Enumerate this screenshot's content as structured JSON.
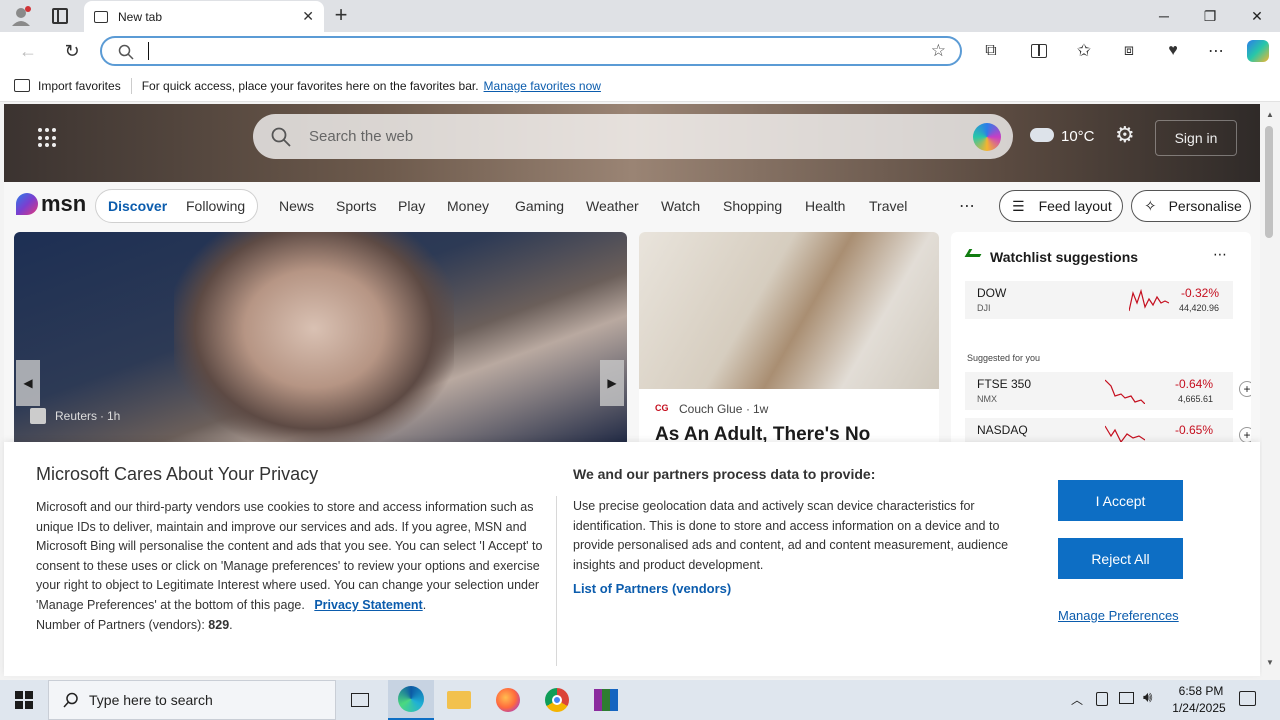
{
  "browser": {
    "tab_title": "New tab",
    "address_value": "",
    "favorites_bar": {
      "import_label": "Import favorites",
      "message": "For quick access, place your favorites here on the favorites bar.",
      "manage_link": "Manage favorites now"
    }
  },
  "msn": {
    "search_placeholder": "Search the web",
    "weather": "10°C",
    "signin": "Sign in",
    "logo": "msn",
    "tabs": [
      "Discover",
      "Following"
    ],
    "nav": [
      "News",
      "Sports",
      "Play",
      "Money",
      "Gaming",
      "Weather",
      "Watch",
      "Shopping",
      "Health",
      "Travel"
    ],
    "feed_layout": "Feed layout",
    "personalise": "Personalise",
    "hero_source": "Reuters",
    "hero_time": "1h",
    "card2_source": "Couch Glue",
    "card2_time": "1w",
    "card2_title": "As An Adult, There's No",
    "watchlist": {
      "title": "Watchlist suggestions",
      "suggested": "Suggested for you",
      "items": [
        {
          "name": "DOW",
          "sub": "DJI",
          "change": "-0.32%",
          "value": "44,420.96"
        },
        {
          "name": "FTSE 350",
          "sub": "NMX",
          "change": "-0.64%",
          "value": "4,665.61"
        },
        {
          "name": "NASDAQ",
          "sub": "",
          "change": "-0.65%",
          "value": ""
        }
      ]
    }
  },
  "privacy": {
    "title": "Microsoft Cares About Your Privacy",
    "body": "Microsoft and our third-party vendors use cookies to store and access information such as unique IDs to deliver, maintain and improve our services and ads. If you agree, MSN and Microsoft Bing will personalise the content and ads that you see. You can select 'I Accept' to consent to these uses or click on 'Manage preferences' to review your options and exercise your right to object to Legitimate Interest where used.  You can change your selection under 'Manage Preferences' at the bottom of this page.",
    "privacy_link": "Privacy Statement",
    "partners_label": "Number of Partners (vendors):",
    "partners_count": "829",
    "right_title": "We and our partners process data to provide:",
    "right_body": "Use precise geolocation data and actively scan device characteristics for identification. This is done to store and access information on a device and to provide personalised ads and content, ad and content measurement, audience insights and product development.",
    "list_link": "List of Partners (vendors)",
    "accept": "I Accept",
    "reject": "Reject All",
    "manage": "Manage Preferences"
  },
  "taskbar": {
    "search_placeholder": "Type here to search",
    "time": "6:58 PM",
    "date": "1/24/2025"
  },
  "colors": {
    "accent": "#0d6ec4",
    "link": "#0b5cad",
    "negative": "#c50f1f"
  }
}
